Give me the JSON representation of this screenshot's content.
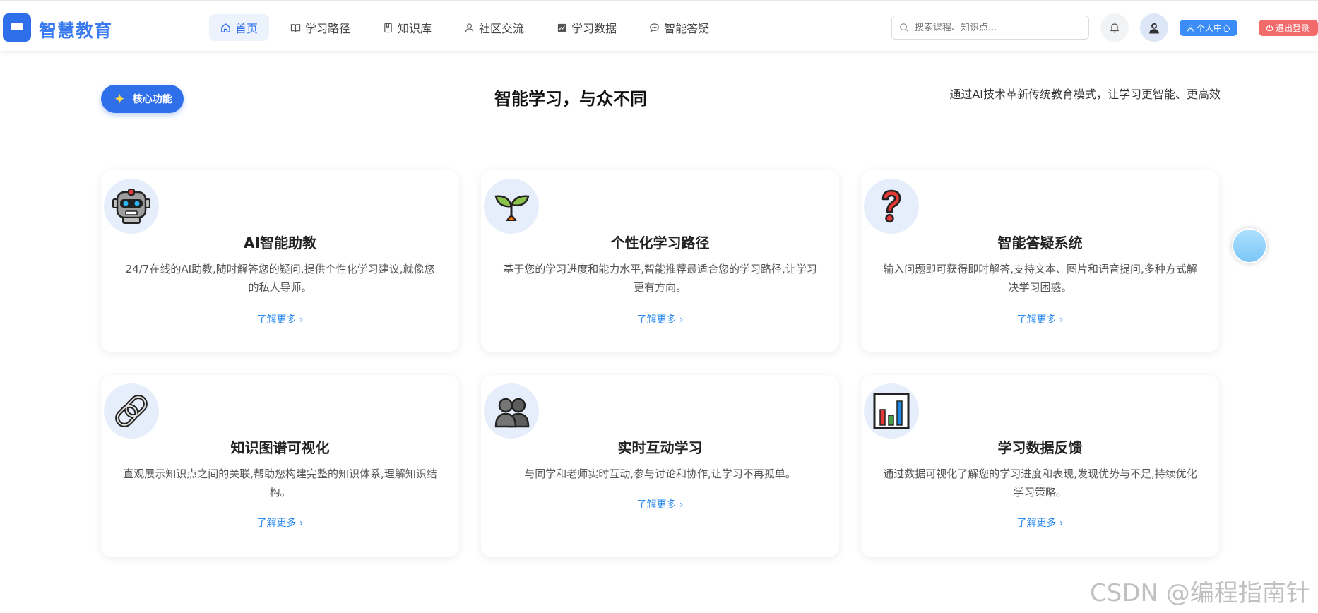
{
  "brand": {
    "name": "智慧教育"
  },
  "nav": [
    {
      "label": "首页",
      "icon": "home-icon"
    },
    {
      "label": "学习路径",
      "icon": "book-open-icon"
    },
    {
      "label": "知识库",
      "icon": "bookmark-book-icon"
    },
    {
      "label": "社区交流",
      "icon": "user-icon"
    },
    {
      "label": "学习数据",
      "icon": "chart-icon"
    },
    {
      "label": "智能答疑",
      "icon": "chat-icon"
    }
  ],
  "search": {
    "placeholder": "搜索课程、知识点..."
  },
  "header_buttons": {
    "profile": "个人中心",
    "logout": "退出登录"
  },
  "section": {
    "badge": "核心功能",
    "title": "智能学习，与众不同",
    "subtitle": "通过AI技术革新传统教育模式，让学习更智能、更高效"
  },
  "features": [
    {
      "title": "AI智能助教",
      "desc": "24/7在线的AI助教,随时解答您的疑问,提供个性化学习建议,就像您的私人导师。",
      "more": "了解更多",
      "icon": "robot-icon"
    },
    {
      "title": "个性化学习路径",
      "desc": "基于您的学习进度和能力水平,智能推荐最适合您的学习路径,让学习更有方向。",
      "more": "了解更多",
      "icon": "seedling-icon"
    },
    {
      "title": "智能答疑系统",
      "desc": "输入问题即可获得即时解答,支持文本、图片和语音提问,多种方式解决学习困惑。",
      "more": "了解更多",
      "icon": "question-mark-icon"
    },
    {
      "title": "知识图谱可视化",
      "desc": "直观展示知识点之间的关联,帮助您构建完整的知识体系,理解知识结构。",
      "more": "了解更多",
      "icon": "link-icon"
    },
    {
      "title": "实时互动学习",
      "desc": "与同学和老师实时互动,参与讨论和协作,让学习不再孤单。",
      "more": "了解更多",
      "icon": "people-icon"
    },
    {
      "title": "学习数据反馈",
      "desc": "通过数据可视化了解您的学习进度和表现,发现优势与不足,持续优化学习策略。",
      "more": "了解更多",
      "icon": "bar-chart-icon"
    }
  ],
  "watermark": "CSDN @编程指南针"
}
